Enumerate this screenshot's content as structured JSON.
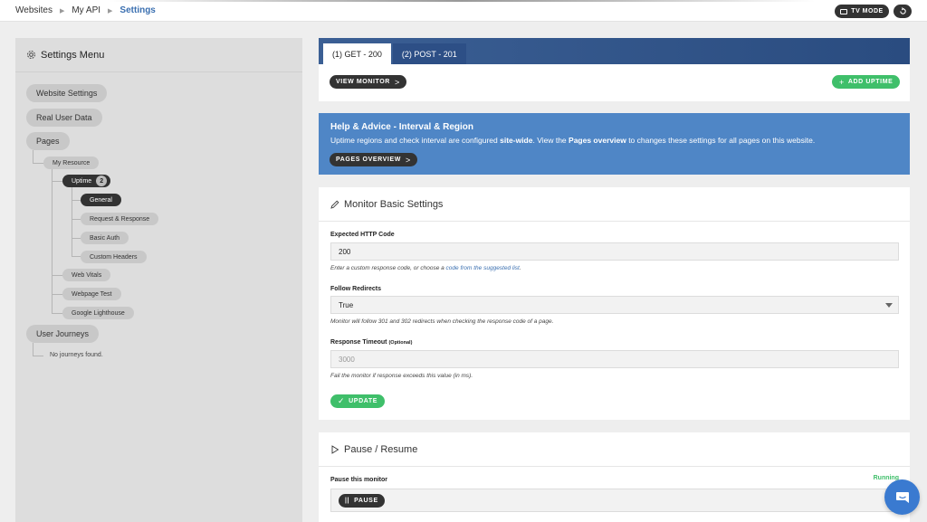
{
  "breadcrumb": {
    "items": [
      "Websites",
      "My API"
    ],
    "current": "Settings"
  },
  "topbar": {
    "tv_mode_label": "TV MODE"
  },
  "sidebar": {
    "title": "Settings Menu",
    "website_settings": "Website Settings",
    "real_user_data": "Real User Data",
    "pages": "Pages",
    "my_resource": "My Resource",
    "uptime": "Uptime",
    "uptime_count": "2",
    "general": "General",
    "request_response": "Request & Response",
    "basic_auth": "Basic Auth",
    "custom_headers": "Custom Headers",
    "web_vitals": "Web Vitals",
    "webpage_test": "Webpage Test",
    "google_lighthouse": "Google Lighthouse",
    "user_journeys": "User Journeys",
    "no_journeys": "No journeys found."
  },
  "tabs": [
    {
      "label": "(1) GET - 200",
      "active": true
    },
    {
      "label": "(2) POST - 201",
      "active": false
    }
  ],
  "actions": {
    "view_monitor": "VIEW MONITOR",
    "add_uptime": "ADD UPTIME"
  },
  "help": {
    "title": "Help & Advice - Interval & Region",
    "text_1": "Uptime regions and check interval are configured ",
    "text_bold_1": "site-wide",
    "text_2": ". View the ",
    "text_bold_2": "Pages overview",
    "text_3": " to changes these settings for all pages on this website.",
    "button": "PAGES OVERVIEW"
  },
  "basic_settings": {
    "title": "Monitor Basic Settings",
    "http_code_label": "Expected HTTP Code",
    "http_code_value": "200",
    "http_code_help_1": "Enter a custom response code, or choose a ",
    "http_code_help_link": "code from the suggested list",
    "http_code_help_2": ".",
    "follow_label": "Follow Redirects",
    "follow_value": "True",
    "follow_help": "Monitor will follow 301 and 302 redirects when checking the response code of a page.",
    "timeout_label": "Response Timeout",
    "timeout_optional": "(Optional)",
    "timeout_placeholder": "3000",
    "timeout_help": "Fail the monitor if response exceeds this value (in ms).",
    "update_button": "UPDATE"
  },
  "pause": {
    "title": "Pause / Resume",
    "label": "Pause this monitor",
    "status": "Running",
    "button": "PAUSE"
  },
  "colors": {
    "accent_blue": "#4f86c6",
    "success_green": "#3fbf6a",
    "dark": "#333333"
  }
}
